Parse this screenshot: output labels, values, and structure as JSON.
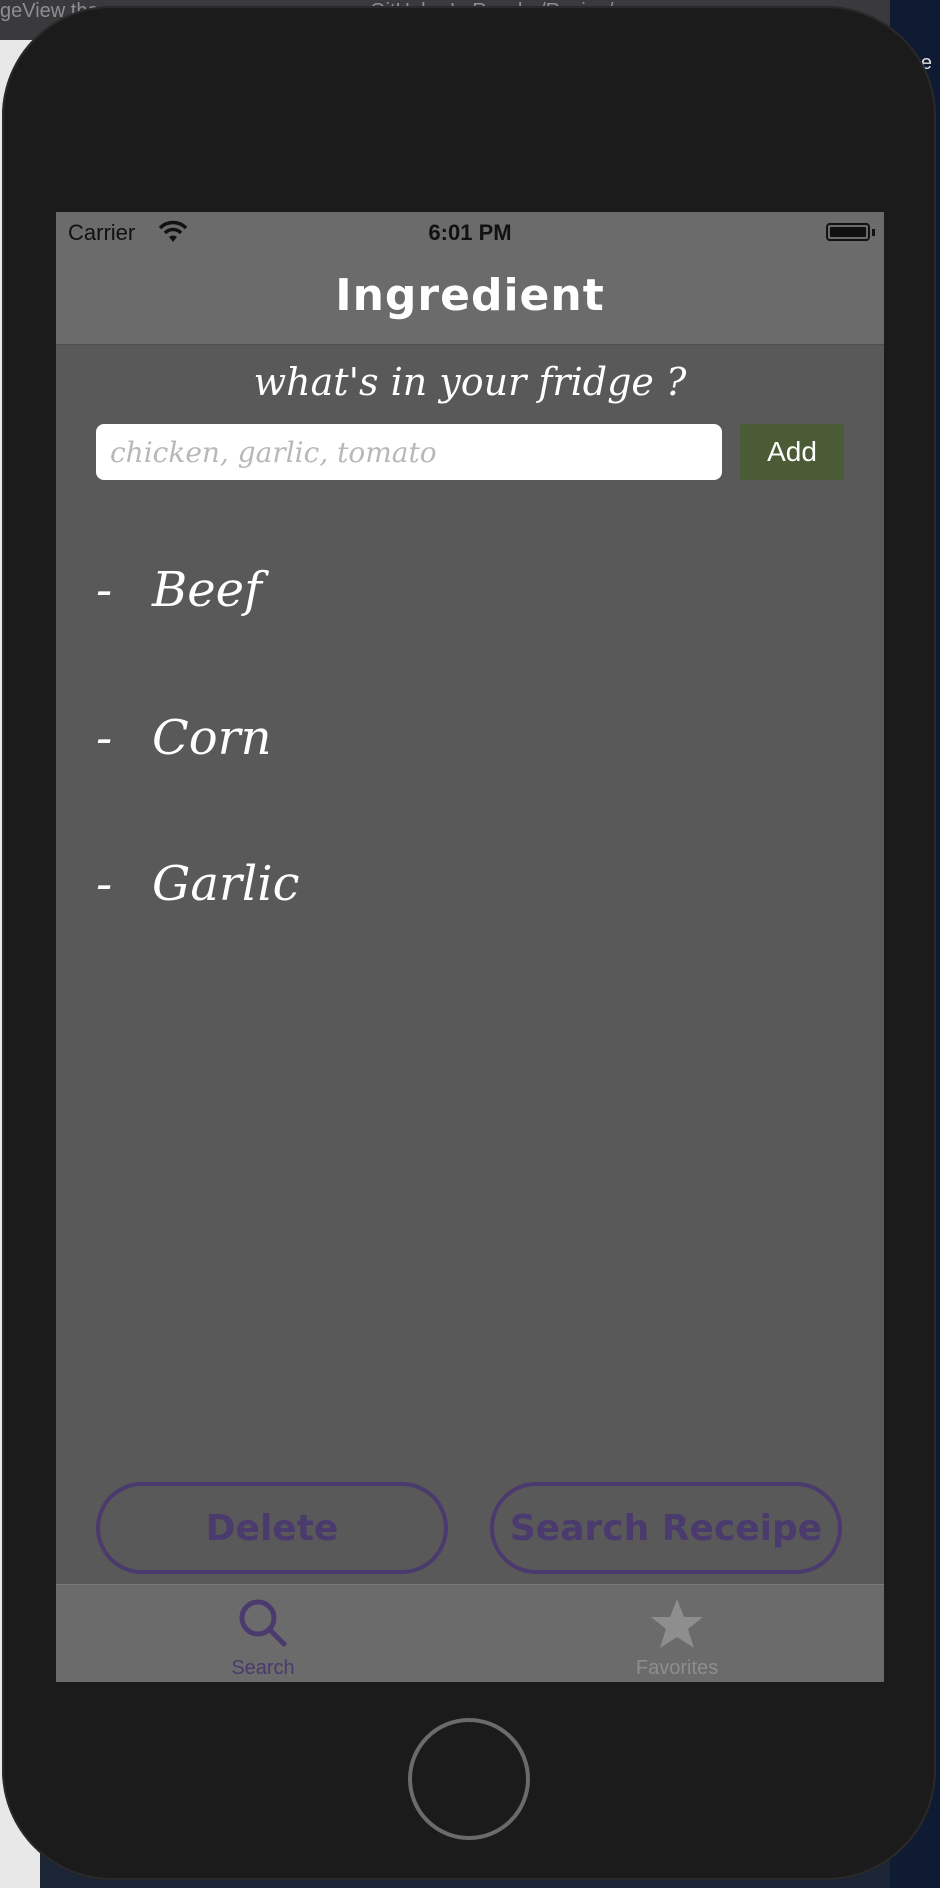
{
  "desktop": {
    "top_left_text": "geView the...",
    "top_center_text": "GitHub - LoRoyche/Recipe/...",
    "right_edge_text": "e"
  },
  "status_bar": {
    "carrier": "Carrier",
    "time": "6:01 PM"
  },
  "nav": {
    "title": "Ingredient"
  },
  "search": {
    "prompt": "what's in your fridge ?",
    "placeholder": "chicken, garlic, tomato",
    "value": "",
    "add_label": "Add"
  },
  "ingredients": [
    {
      "dash": "-",
      "name": "Beef"
    },
    {
      "dash": "-",
      "name": "Corn"
    },
    {
      "dash": "-",
      "name": "Garlic"
    }
  ],
  "actions": {
    "delete_label": "Delete",
    "search_label": "Search Receipe"
  },
  "tabs": [
    {
      "label": "Search",
      "icon": "search-icon",
      "selected": true
    },
    {
      "label": "Favorites",
      "icon": "star-icon",
      "selected": false
    }
  ],
  "colors": {
    "accent_purple": "#4a3a6e",
    "add_button": "#4a5b36",
    "screen_bg": "#595959",
    "bar_bg": "#6b6b6b"
  }
}
